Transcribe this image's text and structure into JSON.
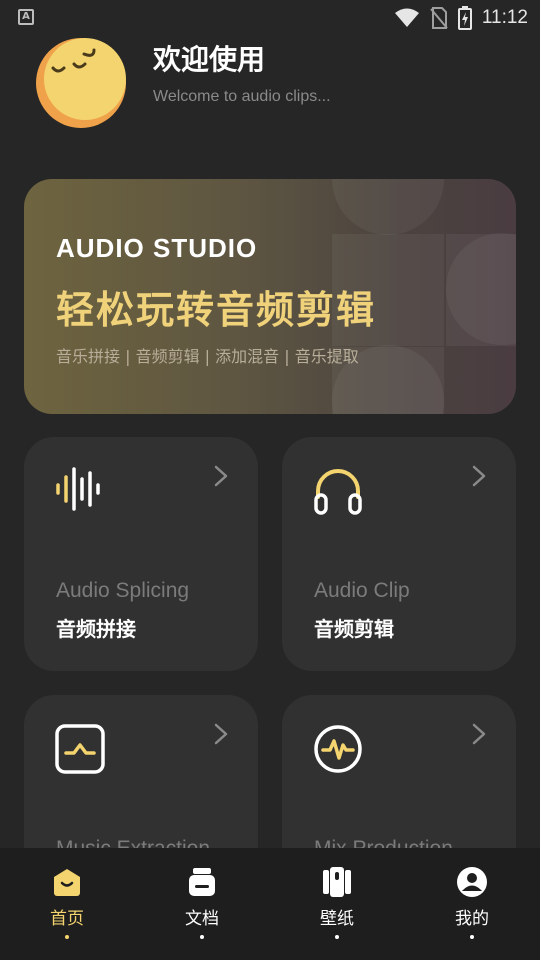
{
  "statusbar": {
    "time": "11:12",
    "notification_icon": "a-icon"
  },
  "header": {
    "title": "欢迎使用",
    "subtitle": "Welcome to audio clips..."
  },
  "banner": {
    "brand": "AUDIO STUDIO",
    "headline": "轻松玩转音频剪辑",
    "tags": "音乐拼接 | 音频剪辑 | 添加混音 | 音乐提取"
  },
  "cards": [
    {
      "en": "Audio Splicing",
      "zh": "音频拼接",
      "icon": "waveform-icon"
    },
    {
      "en": "Audio Clip",
      "zh": "音频剪辑",
      "icon": "headphones-icon"
    },
    {
      "en": "Music Extraction",
      "zh": "",
      "icon": "extract-icon"
    },
    {
      "en": "Mix Production",
      "zh": "",
      "icon": "pulse-icon"
    }
  ],
  "nav": [
    {
      "label": "首页",
      "icon": "home-icon",
      "active": true
    },
    {
      "label": "文档",
      "icon": "document-icon",
      "active": false
    },
    {
      "label": "壁纸",
      "icon": "wallpaper-icon",
      "active": false
    },
    {
      "label": "我的",
      "icon": "profile-icon",
      "active": false
    }
  ],
  "colors": {
    "accent": "#f3d46e",
    "background": "#262626",
    "card": "#313131",
    "nav": "#1e1e1e"
  }
}
